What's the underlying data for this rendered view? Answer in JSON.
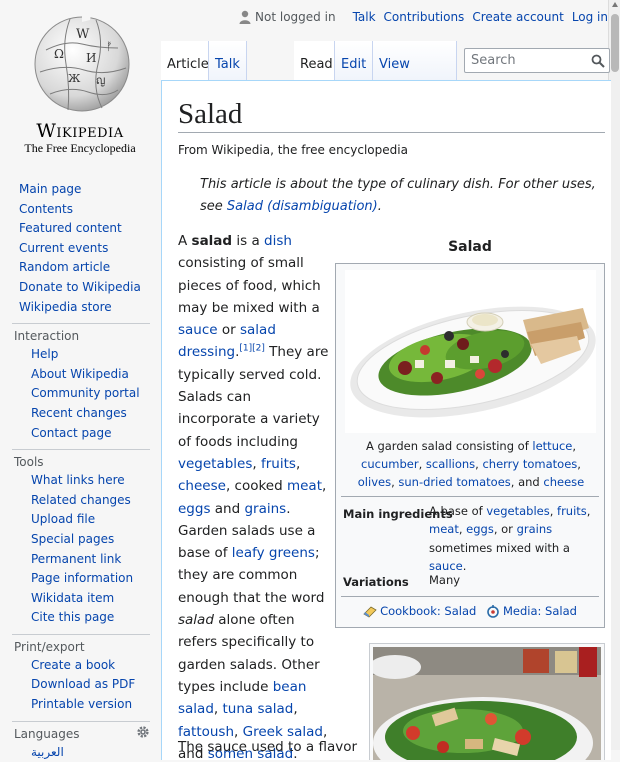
{
  "personal": {
    "not_logged_in": "Not logged in",
    "talk": "Talk",
    "contributions": "Contributions",
    "create_account": "Create account",
    "log_in": "Log in"
  },
  "logo": {
    "wordmark": "Wikipedia",
    "tagline": "The Free Encyclopedia"
  },
  "navigation": [
    "Main page",
    "Contents",
    "Featured content",
    "Current events",
    "Random article",
    "Donate to Wikipedia",
    "Wikipedia store"
  ],
  "interaction": {
    "heading": "Interaction",
    "items": [
      "Help",
      "About Wikipedia",
      "Community portal",
      "Recent changes",
      "Contact page"
    ]
  },
  "tools": {
    "heading": "Tools",
    "items": [
      "What links here",
      "Related changes",
      "Upload file",
      "Special pages",
      "Permanent link",
      "Page information",
      "Wikidata item",
      "Cite this page"
    ]
  },
  "printexport": {
    "heading": "Print/export",
    "items": [
      "Create a book",
      "Download as PDF",
      "Printable version"
    ]
  },
  "languages": {
    "heading": "Languages",
    "first": "العربية"
  },
  "tabs": {
    "article": "Article",
    "talk": "Talk",
    "read": "Read",
    "edit": "Edit",
    "history": "View history"
  },
  "search": {
    "placeholder": "Search"
  },
  "article": {
    "title": "Salad",
    "site_sub": "From Wikipedia, the free encyclopedia",
    "hatnote_text": "This article is about the type of culinary dish. For other uses, see",
    "hatnote_link": "Salad (disambiguation)",
    "hatnote_end": ".",
    "body": {
      "a": "A ",
      "salad": "salad",
      "is_a": " is a ",
      "dish": "dish",
      "t1": " consisting of small pieces of food, which may be mixed with a ",
      "sauce": "sauce",
      "or": " or ",
      "dressing": "salad dressing",
      "refs": "[1][2]",
      "t2": " They are typically served cold. Salads can incorporate a variety of foods including ",
      "vegetables": "vegetables",
      "c1": ", ",
      "fruits": "fruits",
      "c2": ", ",
      "cheese": "cheese",
      "t3": ", cooked ",
      "meat": "meat",
      "c3": ", ",
      "eggs": "eggs",
      "and": " and ",
      "grains": "grains",
      "t4": ". Garden salads use a base of ",
      "leafy": "leafy greens",
      "t5": "; they are common enough that the word ",
      "salad_it": "salad",
      "t6": " alone often refers specifically to garden salads. Other types include ",
      "bean": "bean salad",
      "c4": ", ",
      "tuna": "tuna salad",
      "c5": ", ",
      "fattoush": "fattoush",
      "c6": ", ",
      "greek": "Greek salad",
      "and2": ", and ",
      "somen": "somen salad",
      "end": ".",
      "tail": "The sauce used to a flavor"
    }
  },
  "infobox": {
    "title": "Salad",
    "caption": {
      "pre": "A garden salad consisting of ",
      "lettuce": "lettuce",
      "c1": ", ",
      "cucumber": "cucumber",
      "c2": ", ",
      "scallions": "scallions",
      "c3": ", ",
      "tomatoes": "cherry tomatoes",
      "c4": ", ",
      "olives": "olives",
      "c5": ", ",
      "sundried": "sun-dried tomatoes",
      "post": ", and ",
      "cheese": "cheese"
    },
    "main_label": "Main ingredients",
    "main": {
      "pre": "A base of ",
      "vegetables": "vegetables",
      "c1": ", ",
      "fruits": "fruits",
      "c2": ", ",
      "meat": "meat",
      "c3": ", ",
      "eggs": "eggs",
      "or": ", or ",
      "grains": "grains",
      "mid": " sometimes mixed with a ",
      "sauce": "sauce",
      "end": "."
    },
    "variations_label": "Variations",
    "variations_value": "Many",
    "cookbook": "Cookbook: Salad",
    "media": "Media: Salad"
  },
  "colors": {
    "link": "#0645ad",
    "text": "#202122",
    "background": "#f6f6f6",
    "border": "#a7d7f9"
  }
}
